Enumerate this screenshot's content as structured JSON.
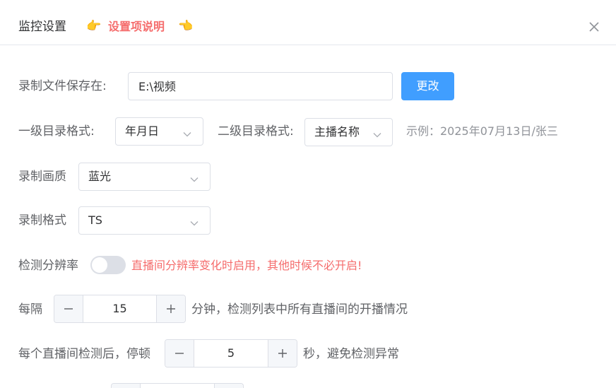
{
  "dialog": {
    "title": "监控设置",
    "hand_left": "👉",
    "help_link": "设置项说明",
    "hand_right": "👈"
  },
  "save_path": {
    "label": "录制文件保存在:",
    "value": "E:\\视频",
    "change_button": "更改"
  },
  "directory": {
    "level1_label": "一级目录格式:",
    "level1_value": "年月日",
    "level2_label": "二级目录格式:",
    "level2_value": "主播名称",
    "example": "示例：2025年07月13日/张三"
  },
  "quality": {
    "label": "录制画质",
    "value": "蓝光"
  },
  "format": {
    "label": "录制格式",
    "value": "TS"
  },
  "resolution_detect": {
    "label": "检测分辨率",
    "enabled": false,
    "warning": "直播间分辨率变化时启用，其他时候不必开启!"
  },
  "interval": {
    "label": "每隔",
    "value": "15",
    "suffix": "分钟，检测列表中所有直播间的开播情况"
  },
  "pause": {
    "label": "每个直播间检测后，停顿",
    "value": "5",
    "suffix": "秒，避免检测异常"
  }
}
